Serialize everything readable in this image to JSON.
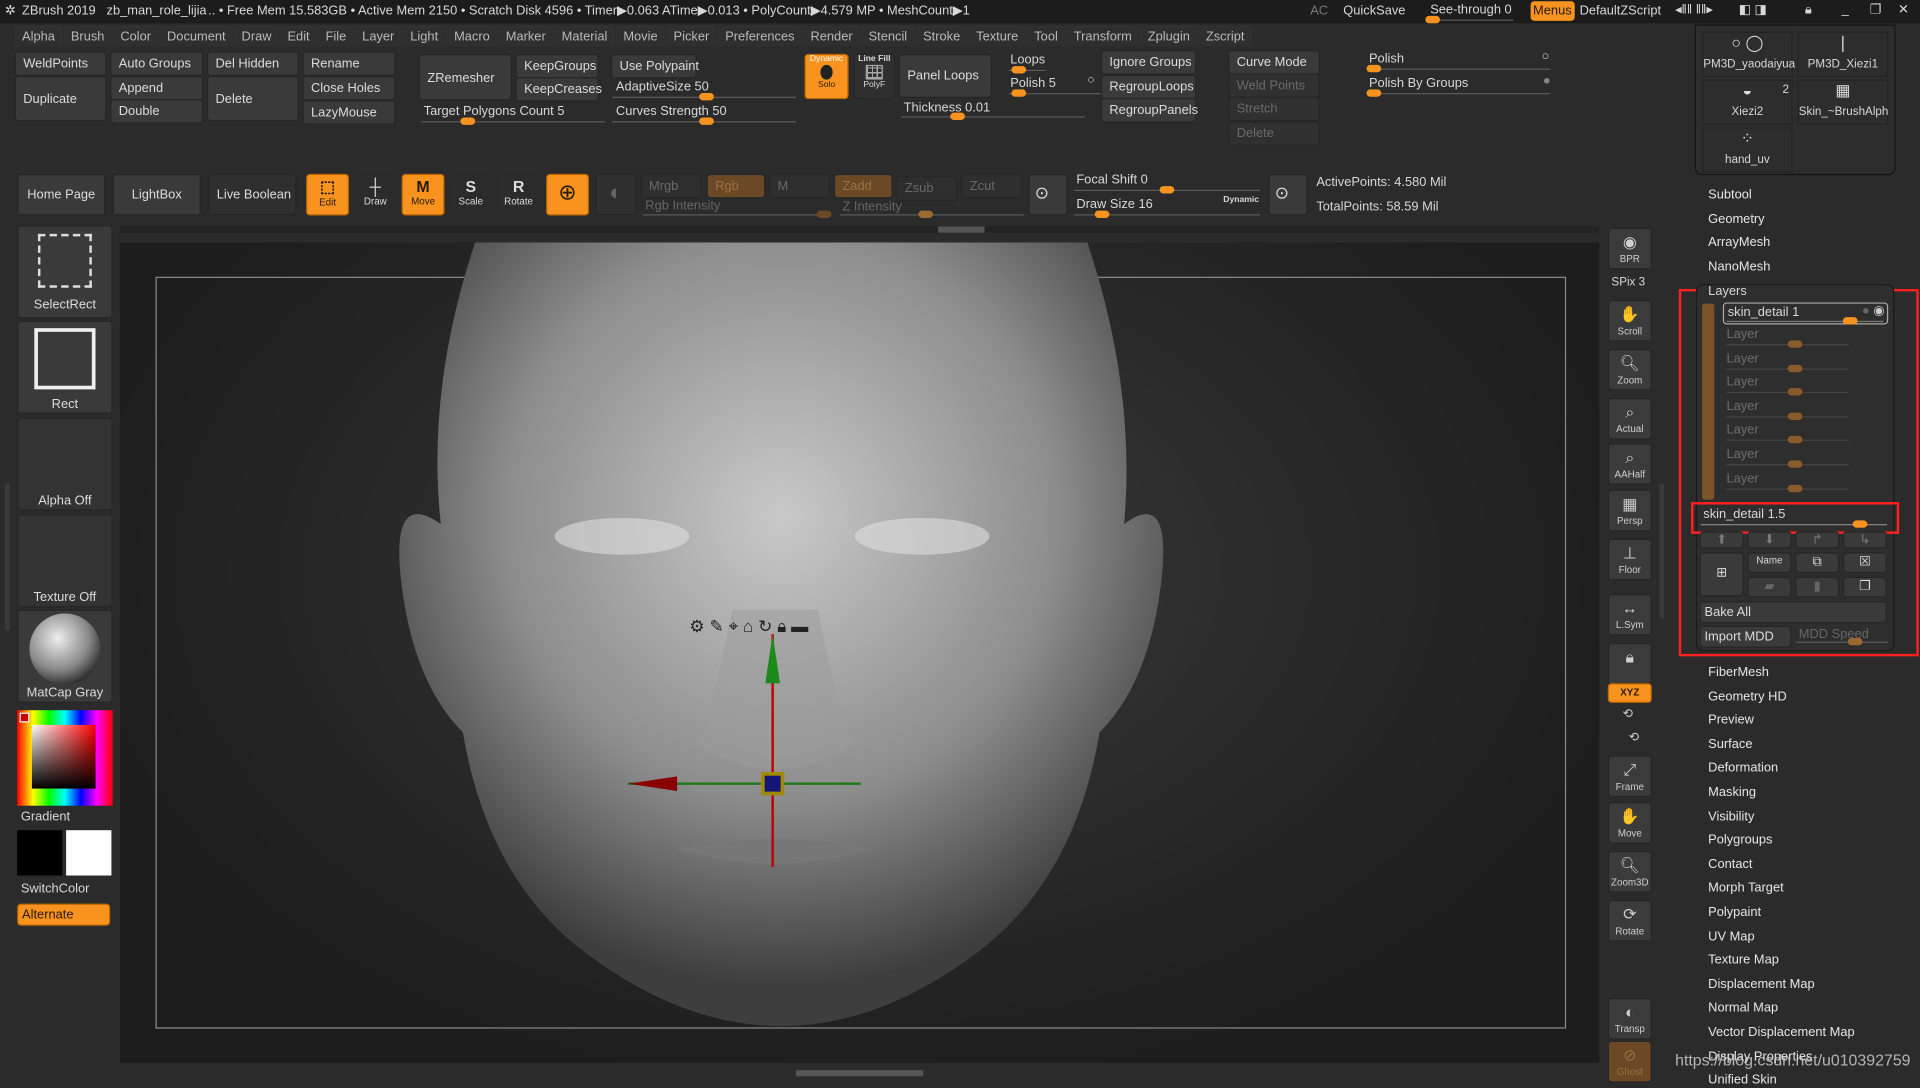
{
  "title_bar": {
    "app": "ZBrush 2019",
    "file": "zb_man_role_lijia",
    "stats": ".. • Free Mem 15.583GB • Active Mem 2150 • Scratch Disk 4596 • Timer▶0.063 ATime▶0.013 • PolyCount▶4.579 MP • MeshCount▶1",
    "ac": "AC",
    "quicksave": "QuickSave",
    "see_through": "See-through 0",
    "see_through_value": 0,
    "menus": "Menus",
    "script": "DefaultZScript"
  },
  "menus": [
    "Alpha",
    "Brush",
    "Color",
    "Document",
    "Draw",
    "Edit",
    "File",
    "Layer",
    "Light",
    "Macro",
    "Marker",
    "Material",
    "Movie",
    "Picker",
    "Preferences",
    "Render",
    "Stencil",
    "Stroke",
    "Texture",
    "Tool",
    "Transform",
    "Zplugin",
    "Zscript"
  ],
  "tool_palette": {
    "weldpoints": "WeldPoints",
    "auto_groups": "Auto Groups",
    "del_hidden": "Del Hidden",
    "rename": "Rename",
    "duplicate": "Duplicate",
    "append": "Append",
    "delete": "Delete",
    "close_holes": "Close Holes",
    "double": "Double",
    "lazymouse": "LazyMouse",
    "zremesher": "ZRemesher",
    "keepgroups": "KeepGroups",
    "keepcreases": "KeepCreases",
    "target_polygons": "Target Polygons Count 5",
    "use_polypaint": "Use Polypaint",
    "adaptive_size": "AdaptiveSize 50",
    "curves_strength": "Curves Strength 50",
    "dynamic": "Dynamic",
    "solo": "Solo",
    "line_fill": "Line Fill",
    "polyf": "PolyF",
    "panel_loops": "Panel Loops",
    "thickness": "Thickness 0.01",
    "loops": "Loops",
    "polish": "Polish 5",
    "ignore_groups": "Ignore Groups",
    "regroup_loops": "RegroupLoops",
    "regroup_panels": "RegroupPanels",
    "curve_mode": "Curve Mode",
    "weld_points": "Weld Points",
    "stretch": "Stretch",
    "delete2": "Delete",
    "polish_label": "Polish",
    "polish_by_groups": "Polish By Groups"
  },
  "subtools": [
    {
      "name": "PM3D_yaodaiyua"
    },
    {
      "name": "PM3D_Xiezi1"
    },
    {
      "name": "Xiezi2",
      "badge": "2"
    },
    {
      "name": "Skin_~BrushAlph"
    },
    {
      "name": "hand_uv"
    }
  ],
  "toolbar2": {
    "home": "Home Page",
    "lightbox": "LightBox",
    "live_boolean": "Live Boolean",
    "edit": "Edit",
    "draw": "Draw",
    "move": "Move",
    "scale": "Scale",
    "rotate": "Rotate",
    "mrgb": "Mrgb",
    "rgb": "Rgb",
    "m": "M",
    "zadd": "Zadd",
    "zsub": "Zsub",
    "zcut": "Zcut",
    "rgb_intensity": "Rgb Intensity",
    "z_intensity": "Z Intensity",
    "focal_shift": "Focal Shift 0",
    "draw_size": "Draw Size 16",
    "dynamic": "Dynamic",
    "active_points": "ActivePoints: 4.580 Mil",
    "total_points": "TotalPoints: 58.59 Mil"
  },
  "left_shelf": {
    "selectrect": "SelectRect",
    "rect": "Rect",
    "alpha": "Alpha Off",
    "texture": "Texture Off",
    "matcap": "MatCap Gray",
    "gradient": "Gradient",
    "switchcolor": "SwitchColor",
    "alternate": "Alternate"
  },
  "right_shelf": [
    "BPR",
    "SPix 3",
    "Scroll",
    "Zoom",
    "Actual",
    "AAHalf",
    "Persp",
    "Floor",
    "L.Sym",
    "",
    "XYZ",
    "",
    "",
    "Frame",
    "Move",
    "Zoom3D",
    "Rotate",
    "Transp",
    "Ghost"
  ],
  "tool_menu_top": [
    "Subtool",
    "Geometry",
    "ArrayMesh",
    "NanoMesh"
  ],
  "layers": {
    "title": "Layers",
    "active": "skin_detail 1",
    "empty": [
      "Layer",
      "Layer",
      "Layer",
      "Layer",
      "Layer",
      "Layer",
      "Layer"
    ],
    "selected": "skin_detail 1.5",
    "name_btn": "Name",
    "bake_all": "Bake All",
    "import_mdd": "Import MDD",
    "mdd_speed": "MDD Speed"
  },
  "tool_menu_bottom": [
    "FiberMesh",
    "Geometry HD",
    "Preview",
    "Surface",
    "Deformation",
    "Masking",
    "Visibility",
    "Polygroups",
    "Contact",
    "Morph Target",
    "Polypaint",
    "UV Map",
    "Texture Map",
    "Displacement Map",
    "Normal Map",
    "Vector Displacement Map",
    "Display Properties",
    "Unified Skin"
  ],
  "watermark": "https://blog.csdn.net/u010392759",
  "colors": {
    "accent": "#f7931e",
    "highlight_box": "#ff2020",
    "background": "#2b2b2b"
  }
}
